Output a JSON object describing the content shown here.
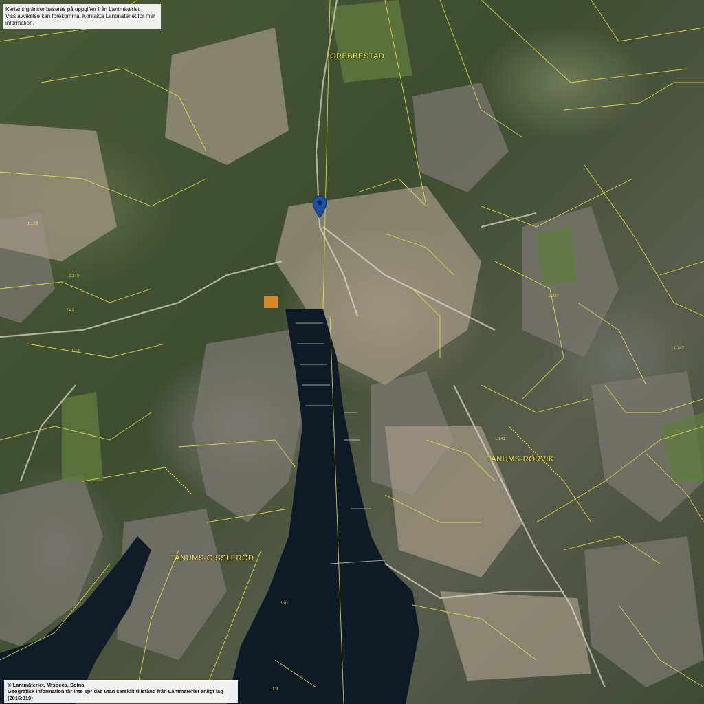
{
  "map": {
    "disclaimer_top": [
      "Kartans gränser baseras på uppgifter från Lantmäteriet.",
      "Viss avvikelse kan förekomma. Kontakta Lantmäteriet för mer information."
    ],
    "disclaimer_bottom": [
      "© Lantmäteriet, Mfspecs, Solna",
      "Geografisk information får inte spridas utan särskilt tillstånd från Lantmäteriet enligt lag (2016:319)"
    ],
    "place_names": {
      "grebbestad": "GREBBESTAD",
      "tanums_rorvik": "TANUMS-RÖRVIK",
      "tanums_gisslerod": "TANUMS-GISSLERÖD"
    },
    "parcel_labels": [
      "1:81",
      "2:297",
      "1:141",
      "1:147",
      "1:123",
      "2:149",
      "2:42",
      "1:12",
      "1:3"
    ],
    "marker_icon": "location-pin-icon",
    "colors": {
      "boundary": "#e6e04a",
      "water": "#0e1a26",
      "marker": "#1f4fa3",
      "label": "#f2e25a"
    }
  }
}
